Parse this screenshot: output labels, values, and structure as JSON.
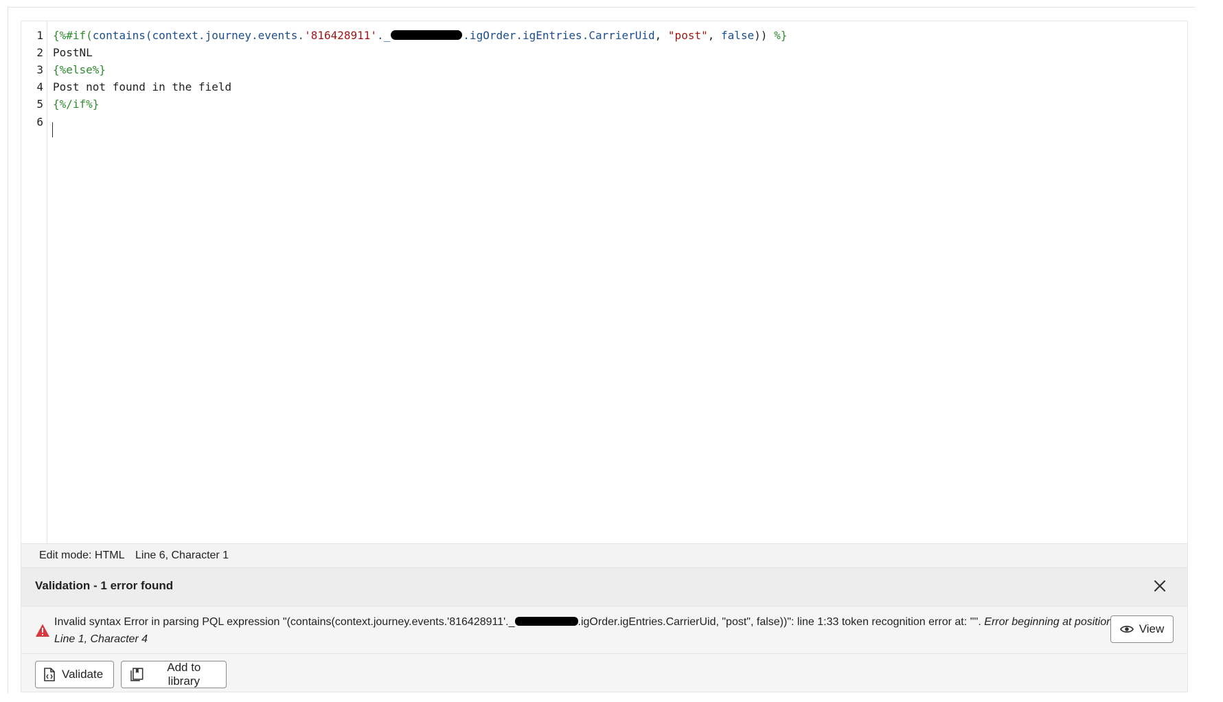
{
  "editor": {
    "line_numbers": [
      "1",
      "2",
      "3",
      "4",
      "5",
      "6"
    ],
    "line1": {
      "open": "{%#if(",
      "fn": "contains(",
      "path1": "context.journey.events.",
      "event_id": "'816428911'",
      "dot": "._",
      "path2": ".igOrder.igEntries.CarrierUid",
      "comma1": ", ",
      "arg": "\"post\"",
      "comma2": ", ",
      "bool": "false",
      "close_paren": ")) ",
      "close": "%}"
    },
    "line2": "PostNL",
    "line3": "{%else%}",
    "line4": "Post not found in the field",
    "line5": "{%/if%}"
  },
  "status_bar": {
    "edit_mode": "Edit mode: HTML",
    "position": "Line 6, Character 1"
  },
  "validation": {
    "title": "Validation - 1 error found",
    "error_part1": "Invalid syntax Error in parsing PQL expression \"(contains(context.journey.events.'816428911'._",
    "error_part2": ".igOrder.igEntries.CarrierUid, \"post\", false))\": line 1:33 token recognition error at: '\"'. ",
    "error_italic": "Error beginning at position: Line 1, Character 4",
    "view_label": "View"
  },
  "footer": {
    "validate_label": "Validate",
    "add_library_label": "Add to library"
  },
  "colors": {
    "tag": "#2e8b2e",
    "function": "#1c4e8a",
    "string": "#a31515",
    "error": "#d7373f"
  },
  "icons": {
    "close": "close-icon",
    "alert": "alert-icon",
    "view": "eye-icon",
    "validate": "file-code-icon",
    "add_library": "library-icon"
  }
}
